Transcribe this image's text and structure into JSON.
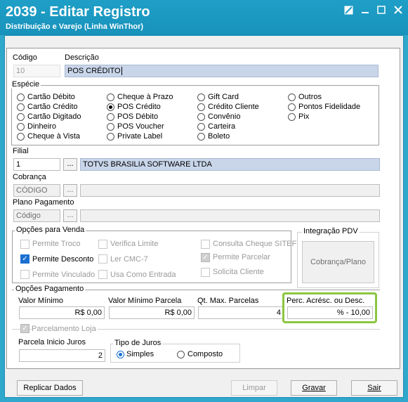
{
  "window": {
    "title": "2039 - Editar Registro",
    "subtitle": "Distribuição e Varejo (Linha WinThor)"
  },
  "header": {
    "codigo_label": "Código",
    "codigo_value": "10",
    "descricao_label": "Descrição",
    "descricao_value": "POS CRÉDITO"
  },
  "especie": {
    "label": "Espécie",
    "options": [
      "Cartão Débito",
      "Cartão Crédito",
      "Cartão Digitado",
      "Dinheiro",
      "Cheque à Vista",
      "Cheque à Prazo",
      "POS Crédito",
      "POS Débito",
      "POS Voucher",
      "Private Label",
      "Gift Card",
      "Crédito Cliente",
      "Convênio",
      "Carteira",
      "Boleto",
      "Outros",
      "Pontos Fidelidade",
      "Pix"
    ],
    "selected": "POS Crédito"
  },
  "filial": {
    "label": "Filial",
    "code": "1",
    "button": "...",
    "name": "TOTVS BRASILIA SOFTWARE LTDA"
  },
  "cobranca": {
    "label": "Cobrança",
    "code": "CÓDIGO",
    "button": "...",
    "name": ""
  },
  "plano": {
    "label": "Plano Pagamento",
    "code": "Código",
    "button": "...",
    "name": ""
  },
  "opcoes_venda": {
    "label": "Opções para Venda",
    "permite_troco": "Permite Troco",
    "permite_desconto": "Permite Desconto",
    "permite_vinculado": "Permite Vinculado",
    "verifica_limite": "Verifica Limite",
    "ler_cmc7": "Ler CMC-7",
    "usa_como_entrada": "Usa Como Entrada",
    "consulta_cheque": "Consulta Cheque SITEF",
    "permite_parcelar": "Permite Parcelar",
    "solicita_cliente": "Solicita Cliente"
  },
  "integracao_pdv": {
    "label": "Integração PDV",
    "button": "Cobrança/Plano"
  },
  "opcoes_pagamento": {
    "label": "Opções Pagamento",
    "valor_minimo_label": "Valor Mínimo",
    "valor_minimo": "R$ 0,00",
    "valor_min_parcela_label": "Valor Mínimo Parcela",
    "valor_min_parcela": "R$ 0,00",
    "qt_max_parcelas_label": "Qt. Max. Parcelas",
    "qt_max_parcelas": "4",
    "perc_label": "Perc. Acrésc. ou Desc.",
    "perc_value": "% - 10,00",
    "parcelamento_loja": "Parcelamento Loja",
    "parcela_inicio_label": "Parcela Inicio Juros",
    "parcela_inicio": "2",
    "tipo_juros_label": "Tipo de Juros",
    "simples": "Simples",
    "composto": "Composto",
    "tipo_selected": "Simples"
  },
  "footer": {
    "replicar": "Replicar Dados",
    "limpar": "Limpar",
    "gravar": "Gravar",
    "sair": "Sair"
  },
  "colors": {
    "titlebar": "#1f9fc7",
    "highlight": "#8cc63f",
    "selected_field": "#c9d6ea"
  }
}
